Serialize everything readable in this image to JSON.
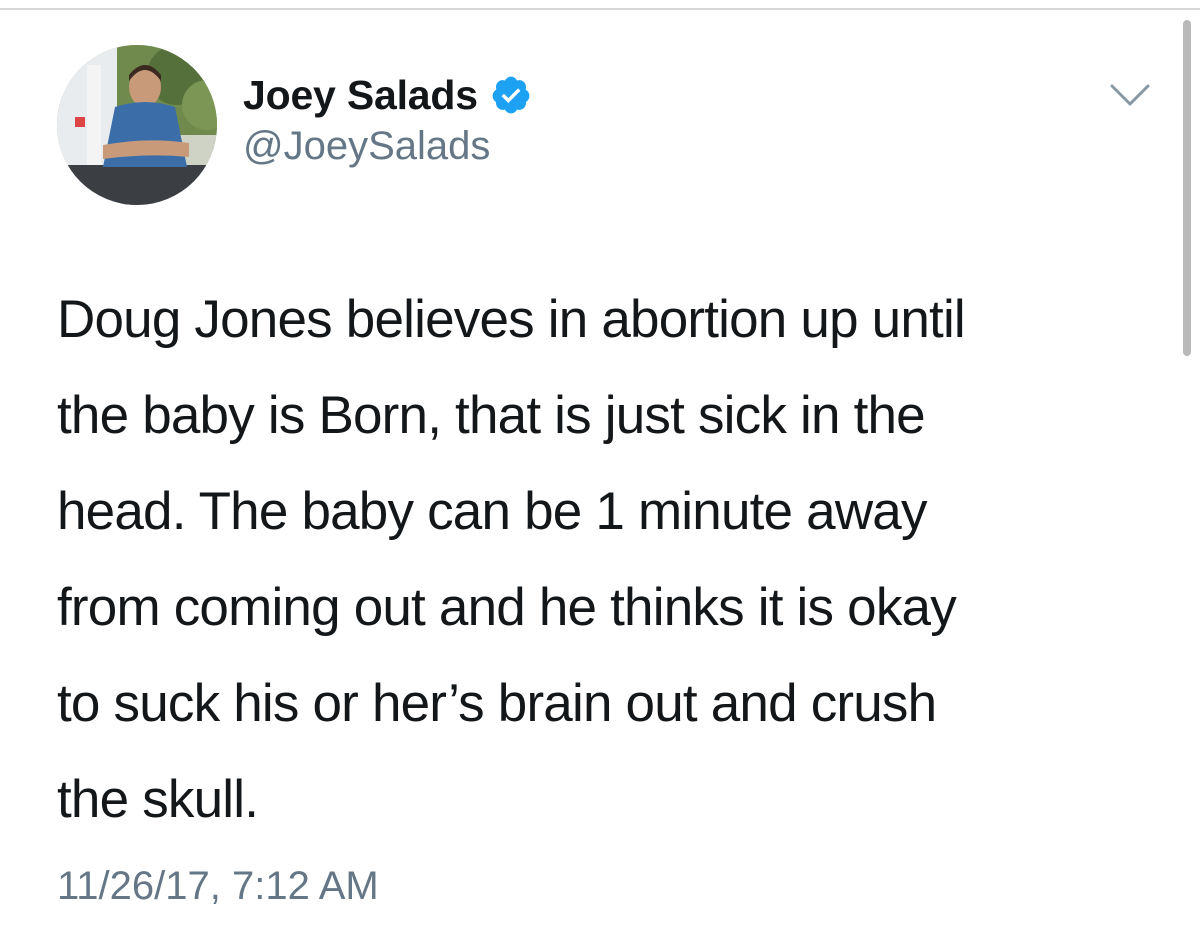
{
  "tweet": {
    "author": {
      "display_name": "Joey Salads",
      "handle": "@JoeySalads",
      "verified": true,
      "verified_icon": "verified-badge-icon"
    },
    "menu_icon": "chevron-down-icon",
    "text_lines": [
      "Doug Jones believes in abortion up until",
      "the baby is Born, that is just sick in the",
      "head. The baby can be 1 minute away",
      "from coming out and he thinks it is okay",
      "to suck his or her’s brain out and crush",
      "the skull."
    ],
    "timestamp": "11/26/17, 7:12 AM"
  },
  "colors": {
    "text_primary": "#14171a",
    "text_secondary": "#657786",
    "verified_blue": "#1da1f2"
  }
}
